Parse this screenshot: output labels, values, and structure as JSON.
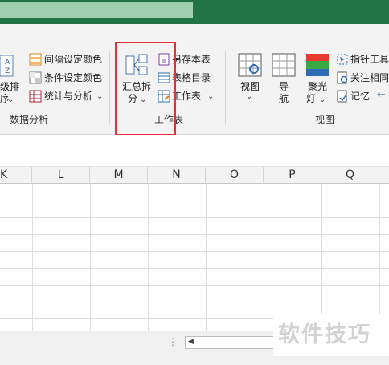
{
  "ribbon": {
    "sort_group": {
      "sort_button_line1": "级排",
      "sort_button_line2": "序",
      "interval_color": "间隔设定颜色",
      "condition_color": "条件设定颜色",
      "stats_analysis": "统计与分析",
      "group_label": "数据分析"
    },
    "workbook_group": {
      "merge_split_line1": "汇总拆",
      "merge_split_line2": "分",
      "save_workbook": "另存本表",
      "table_directory": "表格目录",
      "worksheet": "工作表",
      "group_label": "工作表"
    },
    "view_group": {
      "view_line1": "视图",
      "nav_line1": "导",
      "nav_line2": "航",
      "spotlight_line1": "聚光",
      "spotlight_line2": "灯",
      "pointer_tool": "指针工具",
      "follow_same": "关注相同",
      "memory": "记忆",
      "group_label": "视图"
    }
  },
  "columns": [
    "K",
    "L",
    "M",
    "N",
    "O",
    "P",
    "Q"
  ],
  "watermark": "软件技巧",
  "colors": {
    "title_bar": "#217346",
    "highlight": "#e0323c",
    "ribbon_bg": "#f3f3f3"
  }
}
